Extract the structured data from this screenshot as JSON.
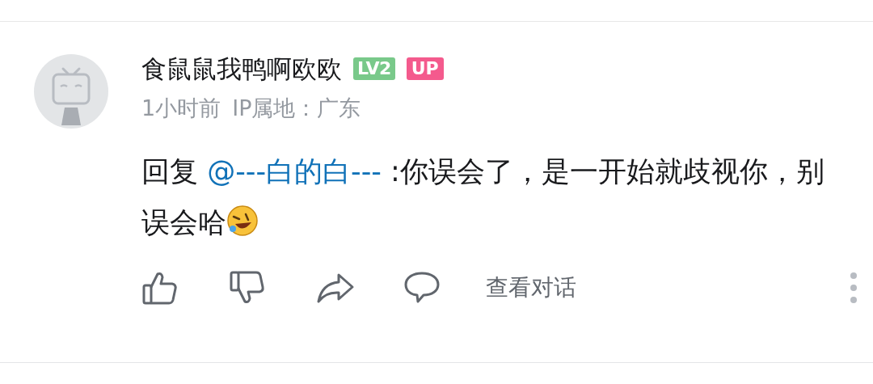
{
  "comment": {
    "username": "食鼠鼠我鸭啊欧欧",
    "badges": [
      {
        "kind": "level",
        "text": "LV2"
      },
      {
        "kind": "up",
        "text": "UP"
      }
    ],
    "time": "1小时前",
    "location": "IP属地：广东",
    "reply": {
      "prefix": "回复",
      "mention": "@---白的白---",
      "text": ":你误会了，是一开始就歧视你，别误会哈"
    },
    "actions": [
      {
        "kind": "like"
      },
      {
        "kind": "dislike"
      },
      {
        "kind": "share"
      },
      {
        "kind": "comment"
      }
    ],
    "view_conversation": "查看对话"
  }
}
